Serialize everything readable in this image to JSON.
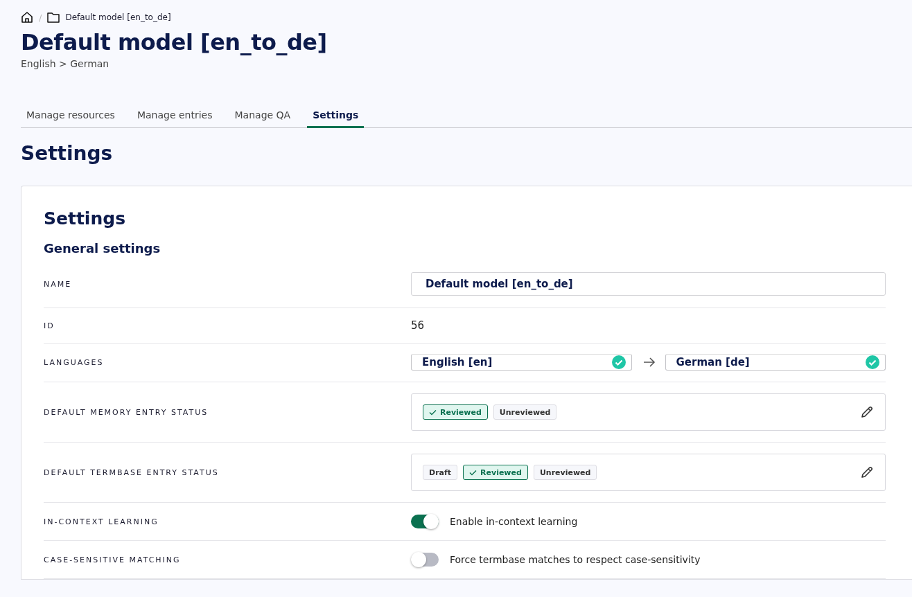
{
  "breadcrumb": {
    "separator": "/",
    "current": "Default model [en_to_de]"
  },
  "title": "Default model [en_to_de]",
  "subtitle": "English > German",
  "tabs": [
    {
      "label": "Manage resources",
      "selected": false
    },
    {
      "label": "Manage entries",
      "selected": false
    },
    {
      "label": "Manage QA",
      "selected": false
    },
    {
      "label": "Settings",
      "selected": true
    }
  ],
  "section_title": "Settings",
  "card": {
    "title": "Settings",
    "subtitle": "General settings",
    "rows": [
      {
        "kind": "input",
        "label": "NAME",
        "value": "Default model [en_to_de]"
      },
      {
        "kind": "text",
        "label": "ID",
        "value": "56"
      },
      {
        "kind": "languages",
        "label": "LANGUAGES",
        "source": "English [en]",
        "target": "German [de]"
      },
      {
        "kind": "statuses",
        "label": "DEFAULT MEMORY ENTRY STATUS",
        "options": [
          {
            "label": "Reviewed",
            "selected": true
          },
          {
            "label": "Unreviewed",
            "selected": false
          }
        ]
      },
      {
        "kind": "statuses",
        "label": "DEFAULT TERMBASE ENTRY STATUS",
        "options": [
          {
            "label": "Draft",
            "selected": false
          },
          {
            "label": "Reviewed",
            "selected": true
          },
          {
            "label": "Unreviewed",
            "selected": false
          }
        ]
      },
      {
        "kind": "toggle",
        "label": "IN-CONTEXT LEARNING",
        "on": true,
        "text": "Enable in-context learning"
      },
      {
        "kind": "toggle",
        "label": "CASE-SENSITIVE MATCHING",
        "on": false,
        "text": "Force termbase matches to respect case-sensitivity"
      }
    ]
  }
}
